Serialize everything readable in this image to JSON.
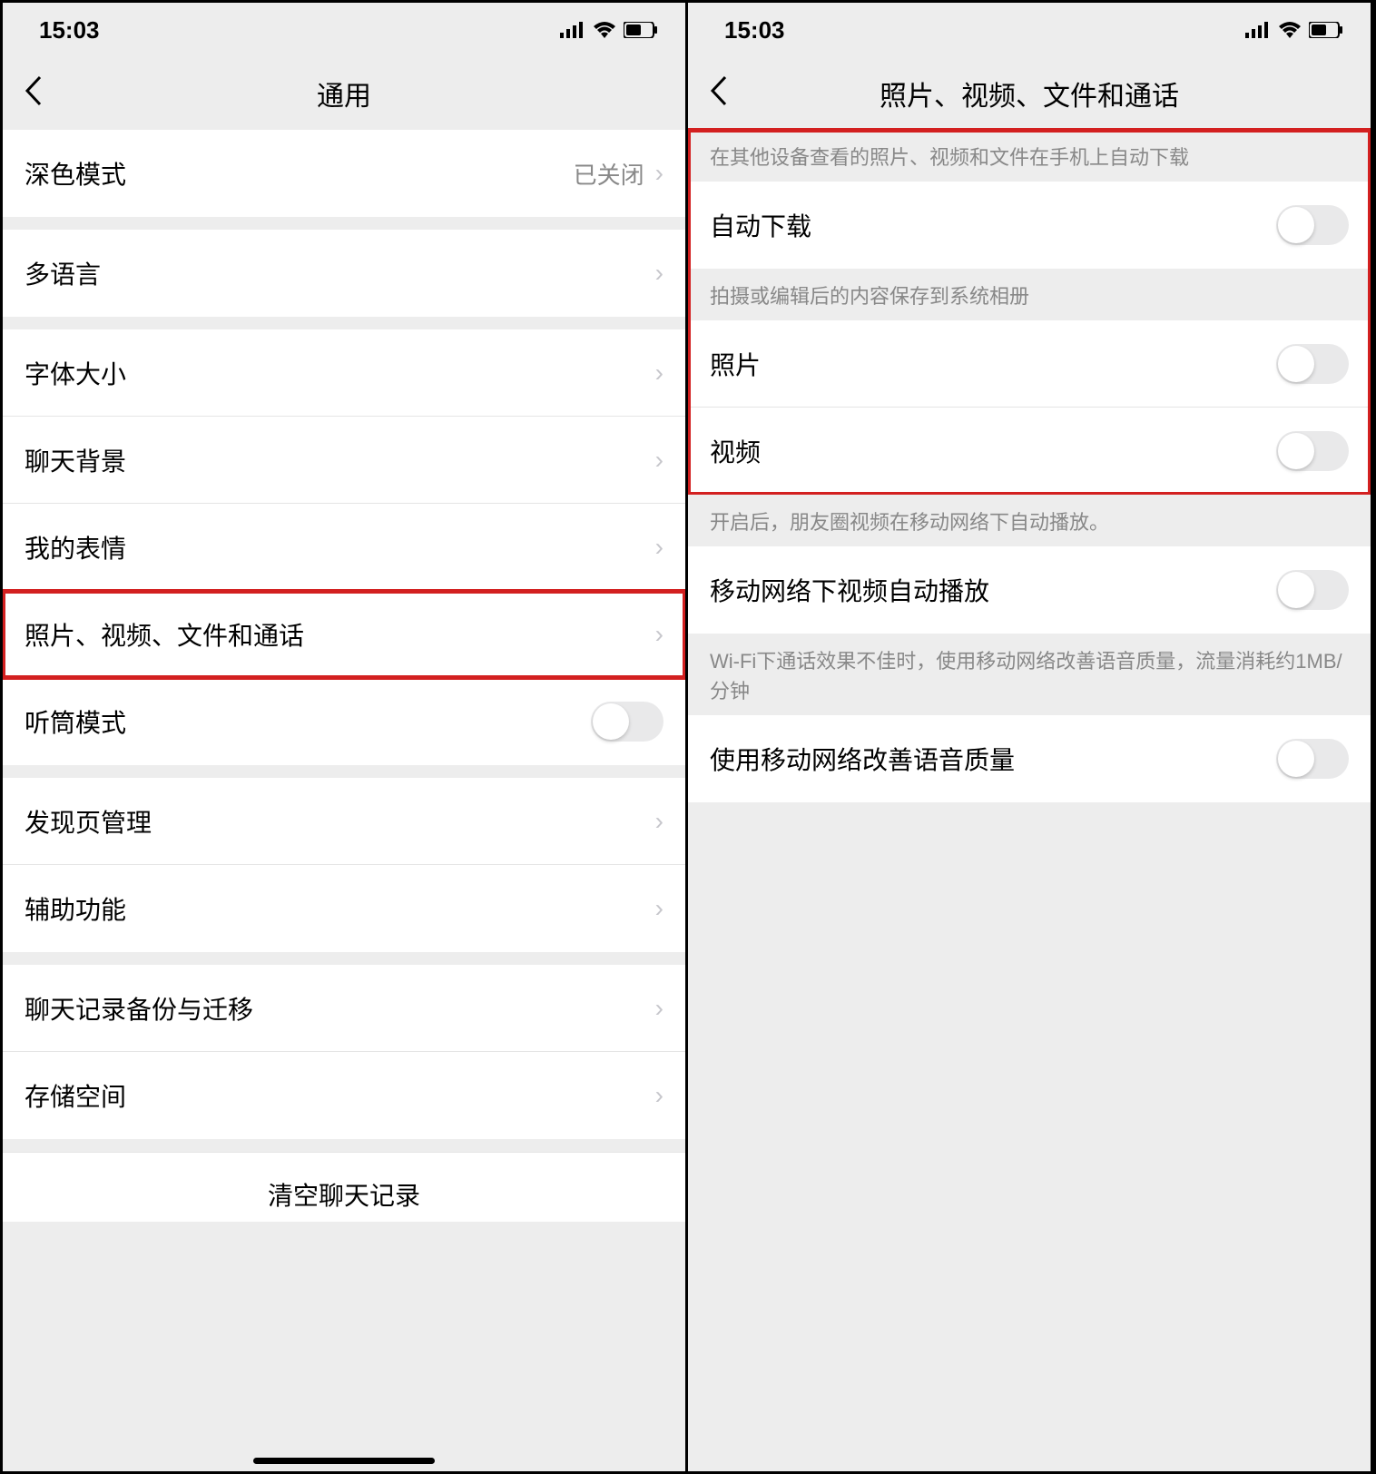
{
  "status": {
    "time": "15:03"
  },
  "left": {
    "title": "通用",
    "rows": {
      "dark_mode": {
        "label": "深色模式",
        "value": "已关闭"
      },
      "multi_lang": {
        "label": "多语言"
      },
      "font_size": {
        "label": "字体大小"
      },
      "chat_bg": {
        "label": "聊天背景"
      },
      "stickers": {
        "label": "我的表情"
      },
      "media": {
        "label": "照片、视频、文件和通话"
      },
      "earpiece": {
        "label": "听筒模式"
      },
      "discover": {
        "label": "发现页管理"
      },
      "accessibility": {
        "label": "辅助功能"
      },
      "chat_backup": {
        "label": "聊天记录备份与迁移"
      },
      "storage": {
        "label": "存储空间"
      }
    },
    "clear": "清空聊天记录"
  },
  "right": {
    "title": "照片、视频、文件和通话",
    "sections": {
      "auto_dl": {
        "header": "在其他设备查看的照片、视频和文件在手机上自动下载",
        "label": "自动下载"
      },
      "save": {
        "header": "拍摄或编辑后的内容保存到系统相册",
        "photo": "照片",
        "video": "视频"
      },
      "autoplay": {
        "header": "开启后，朋友圈视频在移动网络下自动播放。",
        "label": "移动网络下视频自动播放"
      },
      "voip": {
        "header": "Wi-Fi下通话效果不佳时，使用移动网络改善语音质量，流量消耗约1MB/分钟",
        "label": "使用移动网络改善语音质量"
      }
    }
  }
}
